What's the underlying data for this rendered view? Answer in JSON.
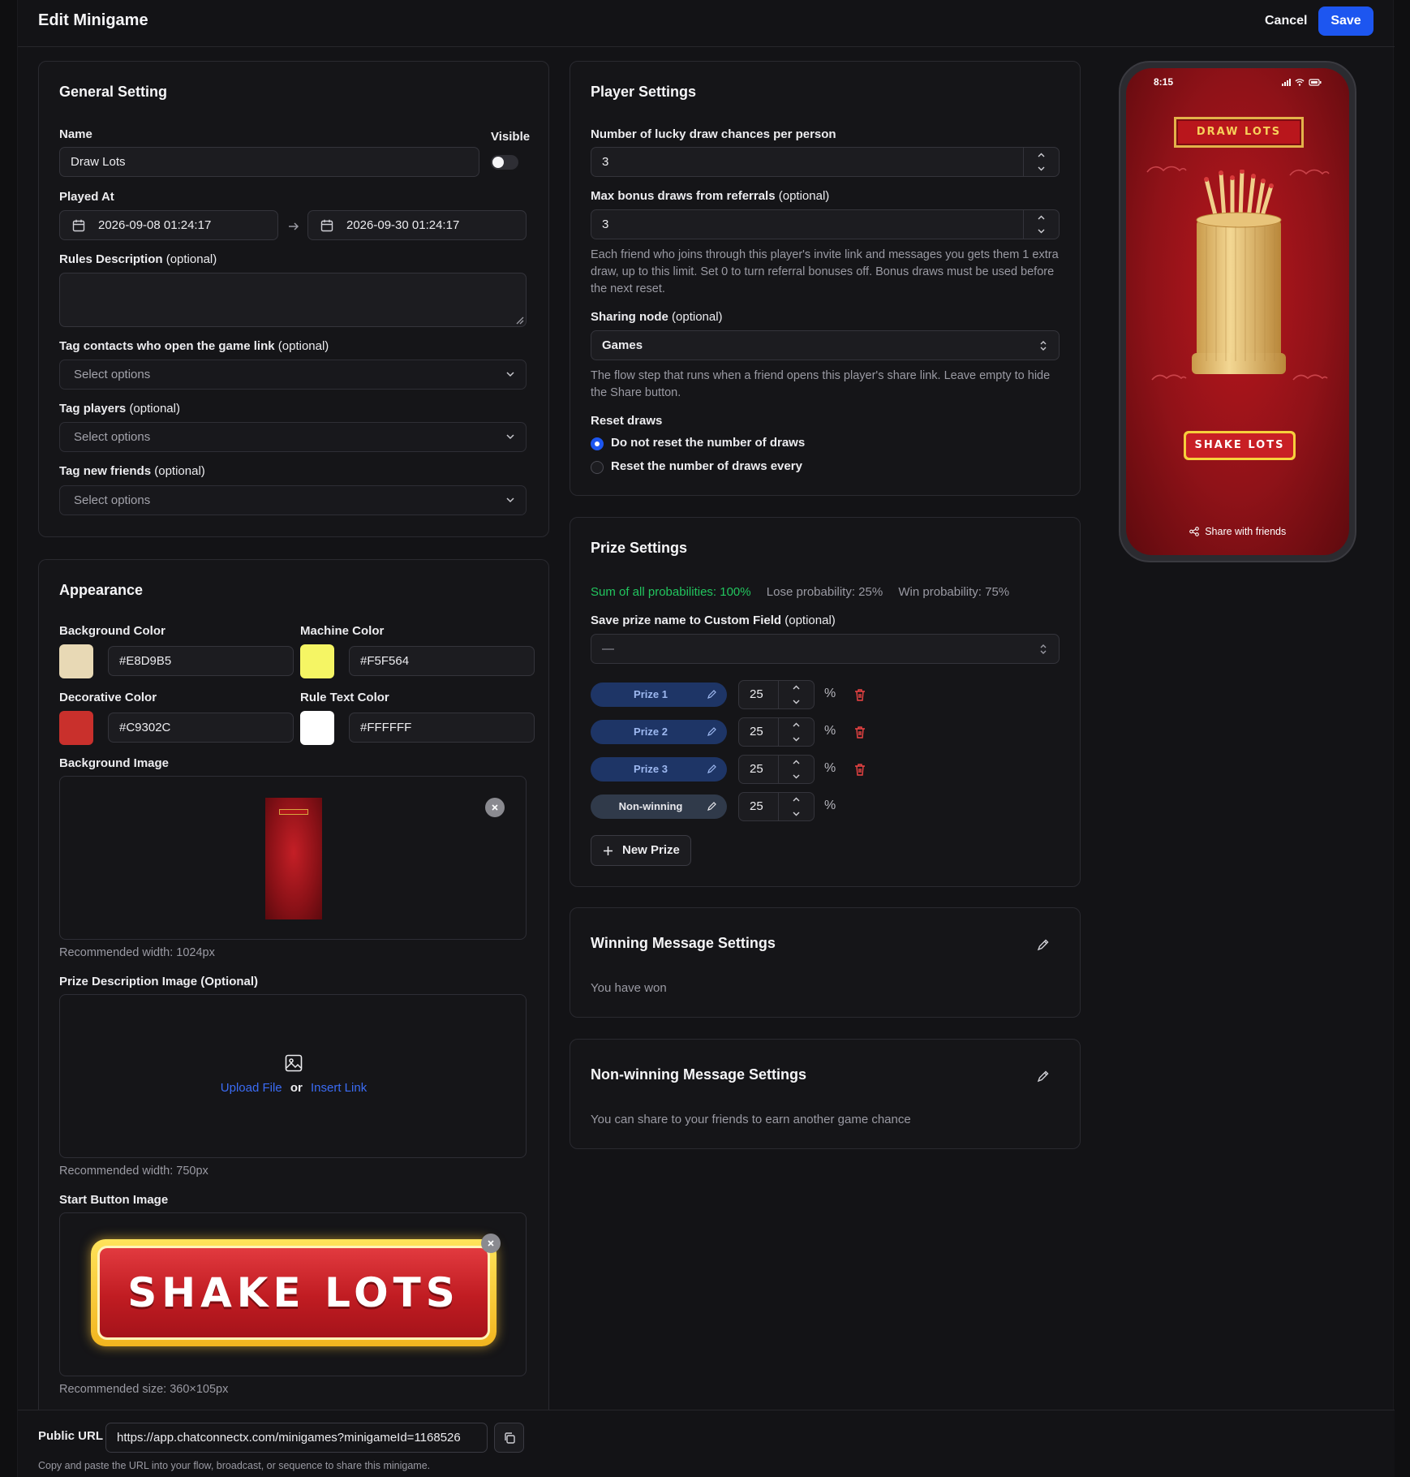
{
  "header": {
    "title": "Edit Minigame",
    "cancel_label": "Cancel",
    "save_label": "Save"
  },
  "general": {
    "title": "General Setting",
    "name_label": "Name",
    "name_value": "Draw Lots",
    "visible_label": "Visible",
    "visible_on": false,
    "played_at_label": "Played At",
    "start_date": "2026-09-08 01:24:17",
    "end_date": "2026-09-30 01:24:17",
    "rules_label": "Rules Description",
    "optional": "(optional)",
    "tag_open_label": "Tag contacts who open the game link",
    "tag_players_label": "Tag players",
    "tag_friends_label": "Tag new friends",
    "select_placeholder": "Select options"
  },
  "appearance": {
    "title": "Appearance",
    "bg_color_label": "Background Color",
    "bg_color": "#E8D9B5",
    "machine_color_label": "Machine Color",
    "machine_color": "#F5F564",
    "decorative_color_label": "Decorative Color",
    "decorative_color": "#C9302C",
    "rule_text_color_label": "Rule Text Color",
    "rule_text_color": "#FFFFFF",
    "bg_image_label": "Background Image",
    "bg_image_note": "Recommended width: 1024px",
    "prize_desc_label": "Prize Description Image (Optional)",
    "upload_file": "Upload File",
    "or_text": "or",
    "insert_link": "Insert Link",
    "prize_desc_note": "Recommended width: 750px",
    "start_btn_label": "Start Button Image",
    "start_btn_image_text": "SHAKE LOTS",
    "start_btn_note": "Recommended size: 360×105px"
  },
  "player": {
    "title": "Player Settings",
    "chances_label": "Number of lucky draw chances per person",
    "chances_value": "3",
    "bonus_label": "Max bonus draws from referrals",
    "optional": "(optional)",
    "bonus_value": "3",
    "bonus_help": "Each friend who joins through this player's invite link and messages you gets them 1 extra draw, up to this limit. Set 0 to turn referral bonuses off. Bonus draws must be used before the next reset.",
    "sharing_label": "Sharing node",
    "sharing_value": "Games",
    "sharing_help": "The flow step that runs when a friend opens this player's share link. Leave empty to hide the Share button.",
    "reset_label": "Reset draws",
    "reset_option_1": "Do not reset the number of draws",
    "reset_option_2": "Reset the number of draws every",
    "reset_selected": 1
  },
  "prize": {
    "title": "Prize Settings",
    "sum_text": "Sum of all probabilities: 100%",
    "lose_text": "Lose probability: 25%",
    "win_text": "Win probability: 75%",
    "save_field_label": "Save prize name to Custom Field",
    "optional": "(optional)",
    "save_field_value": "—",
    "items": [
      {
        "name": "Prize 1",
        "value": "25"
      },
      {
        "name": "Prize 2",
        "value": "25"
      },
      {
        "name": "Prize 3",
        "value": "25"
      },
      {
        "name": "Non-winning",
        "value": "25"
      }
    ],
    "percent": "%",
    "new_prize_label": "New Prize",
    "success_color": "#22c55e"
  },
  "winning": {
    "title": "Winning Message Settings",
    "message": "You have won"
  },
  "nonwinning": {
    "title": "Non-winning Message Settings",
    "message": "You can share to your friends to earn another game chance"
  },
  "preview": {
    "time": "8:15",
    "draw_lots_label": "DRAW LOTS",
    "shake_lots_label": "SHAKE LOTS",
    "share_label": "Share with friends"
  },
  "footer": {
    "url_label": "Public URL",
    "url_value": "https://app.chatconnectx.com/minigames?minigameId=1168526",
    "note": "Copy and paste the URL into your flow, broadcast, or sequence to share this minigame."
  },
  "colors": {
    "accent": "#1d56f0",
    "link": "#3b6cf5",
    "danger": "#ef4444"
  }
}
